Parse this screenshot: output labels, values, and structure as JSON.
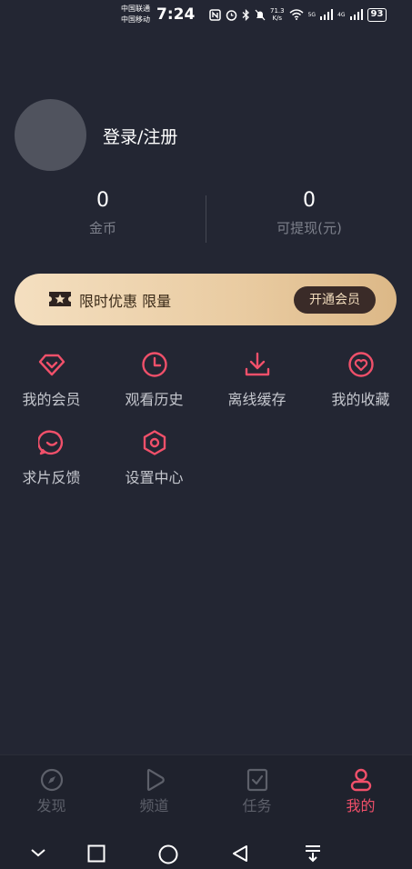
{
  "status_bar": {
    "carrier1": "中国联通",
    "carrier2": "中国移动",
    "time": "7:24",
    "net_speed_value": "71.3",
    "net_speed_unit": "K/s",
    "sig1_label": "5G",
    "sig2_label": "4G",
    "battery": "93"
  },
  "profile": {
    "login_label": "登录/注册"
  },
  "stats": {
    "coins_value": "0",
    "coins_label": "金币",
    "withdraw_value": "0",
    "withdraw_label": "可提现(元)"
  },
  "vip_banner": {
    "text": "限时优惠 限量",
    "button": "开通会员"
  },
  "grid": {
    "items": [
      {
        "label": "我的会员",
        "icon": "diamond-icon"
      },
      {
        "label": "观看历史",
        "icon": "clock-icon"
      },
      {
        "label": "离线缓存",
        "icon": "download-icon"
      },
      {
        "label": "我的收藏",
        "icon": "heart-icon"
      },
      {
        "label": "求片反馈",
        "icon": "chat-icon"
      },
      {
        "label": "设置中心",
        "icon": "settings-icon"
      }
    ]
  },
  "tabbar": {
    "tabs": [
      {
        "label": "发现",
        "icon": "compass-icon",
        "active": false
      },
      {
        "label": "频道",
        "icon": "play-icon",
        "active": false
      },
      {
        "label": "任务",
        "icon": "task-icon",
        "active": false
      },
      {
        "label": "我的",
        "icon": "user-icon",
        "active": true
      }
    ]
  },
  "colors": {
    "background": "#232633",
    "accent": "#f0506a",
    "vip_gold": "#e9cba1",
    "muted_text": "#7d808b"
  }
}
